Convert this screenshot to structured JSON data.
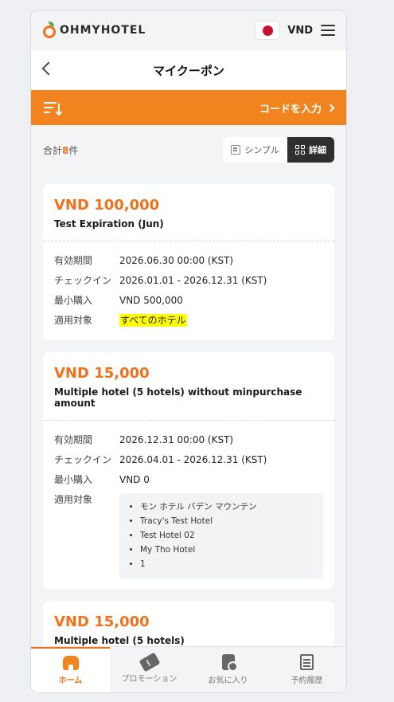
{
  "header": {
    "logo_text": "OHMYHOTEL",
    "currency": "VND"
  },
  "titlebar": {
    "title": "マイクーポン"
  },
  "action_bar": {
    "code_label": "コードを入力"
  },
  "filter": {
    "total_prefix": "合計",
    "total_count": "8",
    "total_suffix": "件",
    "simple_label": "シンプル",
    "detail_label": "詳細"
  },
  "labels": {
    "validity": "有効期間",
    "checkin": "チェックイン",
    "min_purchase": "最小購入",
    "applicable": "適用対象"
  },
  "coupons": [
    {
      "amount": "VND 100,000",
      "name": "Test Expiration (Jun)",
      "validity": "2026.06.30 00:00 (KST)",
      "checkin": "2026.01.01 - 2026.12.31 (KST)",
      "min_purchase": "VND 500,000",
      "applicable": "すべてのホテル"
    },
    {
      "amount": "VND 15,000",
      "name": "Multiple hotel (5 hotels) without minpurchase amount",
      "validity": "2026.12.31 00:00 (KST)",
      "checkin": "2026.04.01 - 2026.12.31 (KST)",
      "min_purchase": "VND 0",
      "hotels": [
        "モン ホテル バデン マウンテン",
        "Tracy's Test Hotel",
        "Test Hotel 02",
        "My Tho Hotel",
        "1"
      ]
    },
    {
      "amount": "VND 15,000",
      "name": "Multiple hotel (5 hotels)"
    }
  ],
  "bottom_nav": [
    {
      "label": "ホーム",
      "icon": "home-icon"
    },
    {
      "label": "プロモーション",
      "icon": "ticket-icon"
    },
    {
      "label": "お気に入り",
      "icon": "favorite-icon"
    },
    {
      "label": "予約履歴",
      "icon": "history-icon"
    }
  ],
  "colors": {
    "accent": "#f2841f",
    "amount": "#f2711c",
    "highlight": "#ffff00"
  }
}
